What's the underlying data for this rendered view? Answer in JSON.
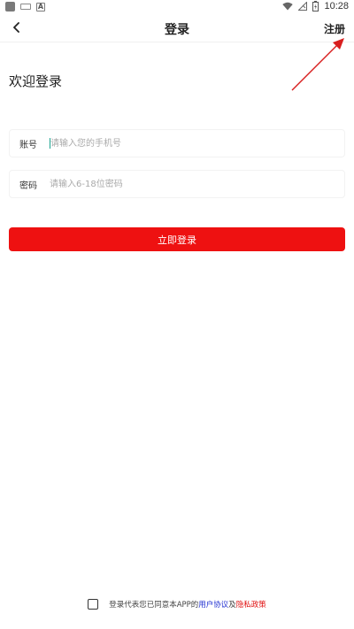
{
  "status_bar": {
    "time": "10:28",
    "icons": [
      "app-icon",
      "keyboard-icon",
      "a-icon",
      "wifi-icon",
      "signal-icon",
      "battery-icon"
    ]
  },
  "header": {
    "title": "登录",
    "register_label": "注册",
    "back_icon": "chevron-left-icon"
  },
  "welcome_text": "欢迎登录",
  "form": {
    "account_label": "账号",
    "account_placeholder": "请输入您的手机号",
    "password_label": "密码",
    "password_placeholder": "请输入6-18位密码",
    "login_button": "立即登录"
  },
  "agreement": {
    "prefix": "登录代表您已同意本APP的",
    "user_agreement": "用户协议",
    "joiner": "及",
    "privacy_policy": "隐私政策"
  },
  "colors": {
    "primary_red": "#ee1111",
    "user_link": "#1f2fd0",
    "privacy_link": "#e01010",
    "annotation_arrow": "#d81e1e"
  }
}
